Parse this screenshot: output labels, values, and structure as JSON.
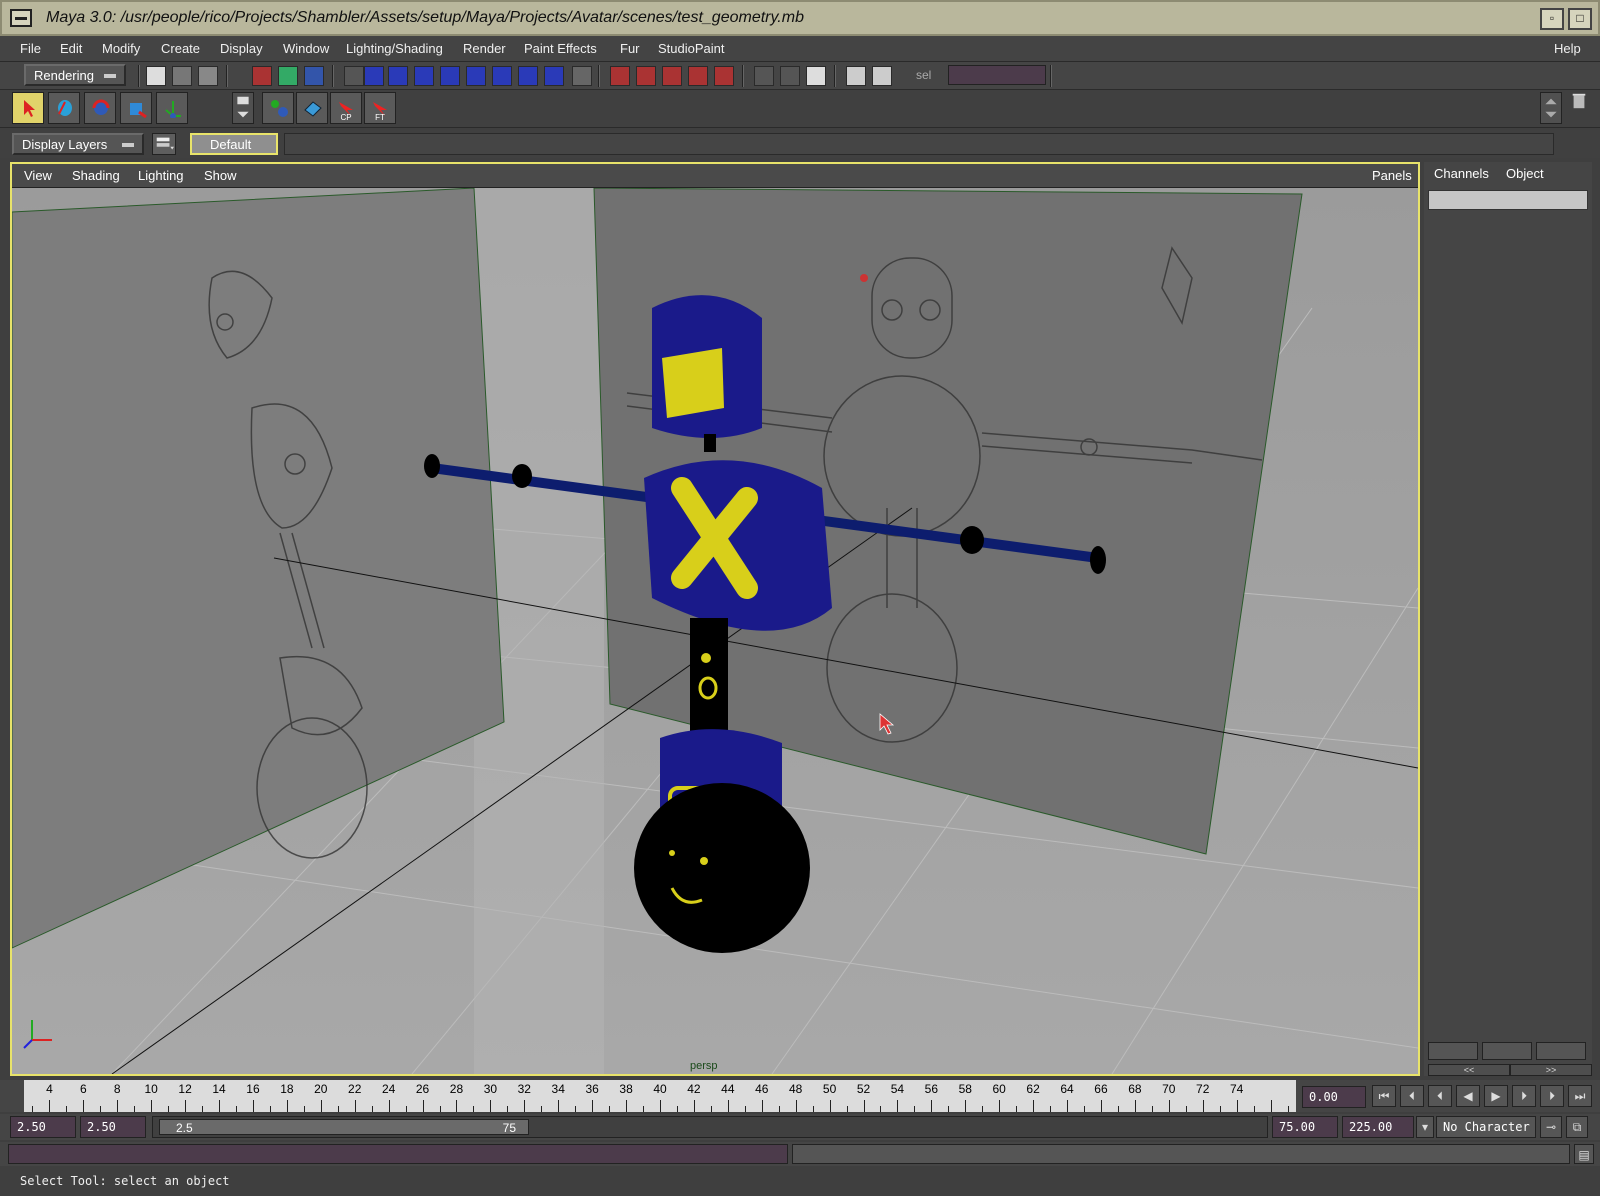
{
  "window": {
    "title": "Maya 3.0: /usr/people/rico/Projects/Shambler/Assets/setup/Maya/Projects/Avatar/scenes/test_geometry.mb"
  },
  "menu": [
    {
      "label": "File"
    },
    {
      "label": "Edit"
    },
    {
      "label": "Modify"
    },
    {
      "label": "Create"
    },
    {
      "label": "Display"
    },
    {
      "label": "Window"
    },
    {
      "label": "Lighting/Shading"
    },
    {
      "label": "Render"
    },
    {
      "label": "Paint Effects"
    },
    {
      "label": "Fur"
    },
    {
      "label": "StudioPaint"
    }
  ],
  "menu_help": "Help",
  "shelf": {
    "mode": "Rendering",
    "sel_label": "sel"
  },
  "tools": {
    "cp": "CP",
    "ft": "FT"
  },
  "layers": {
    "selector": "Display Layers",
    "default_layer": "Default"
  },
  "viewport": {
    "menu": [
      {
        "label": "View"
      },
      {
        "label": "Shading"
      },
      {
        "label": "Lighting"
      },
      {
        "label": "Show"
      }
    ],
    "panels": "Panels",
    "camera": "persp"
  },
  "channel_box": {
    "tab_channels": "Channels",
    "tab_object": "Object",
    "nav_left": "<<",
    "nav_right": ">>"
  },
  "timeline": {
    "ticks": [
      "4",
      "6",
      "8",
      "10",
      "12",
      "14",
      "16",
      "18",
      "20",
      "22",
      "24",
      "26",
      "28",
      "30",
      "32",
      "34",
      "36",
      "38",
      "40",
      "42",
      "44",
      "46",
      "48",
      "50",
      "52",
      "54",
      "56",
      "58",
      "60",
      "62",
      "64",
      "66",
      "68",
      "70",
      "72",
      "74"
    ],
    "current_time": "0.00"
  },
  "range": {
    "start": "2.50",
    "playback_start": "2.50",
    "slider_start": "2.5",
    "slider_end": "75",
    "playback_end": "75.00",
    "end": "225.00",
    "character": "No Character"
  },
  "help_line": "Select Tool: select an object"
}
